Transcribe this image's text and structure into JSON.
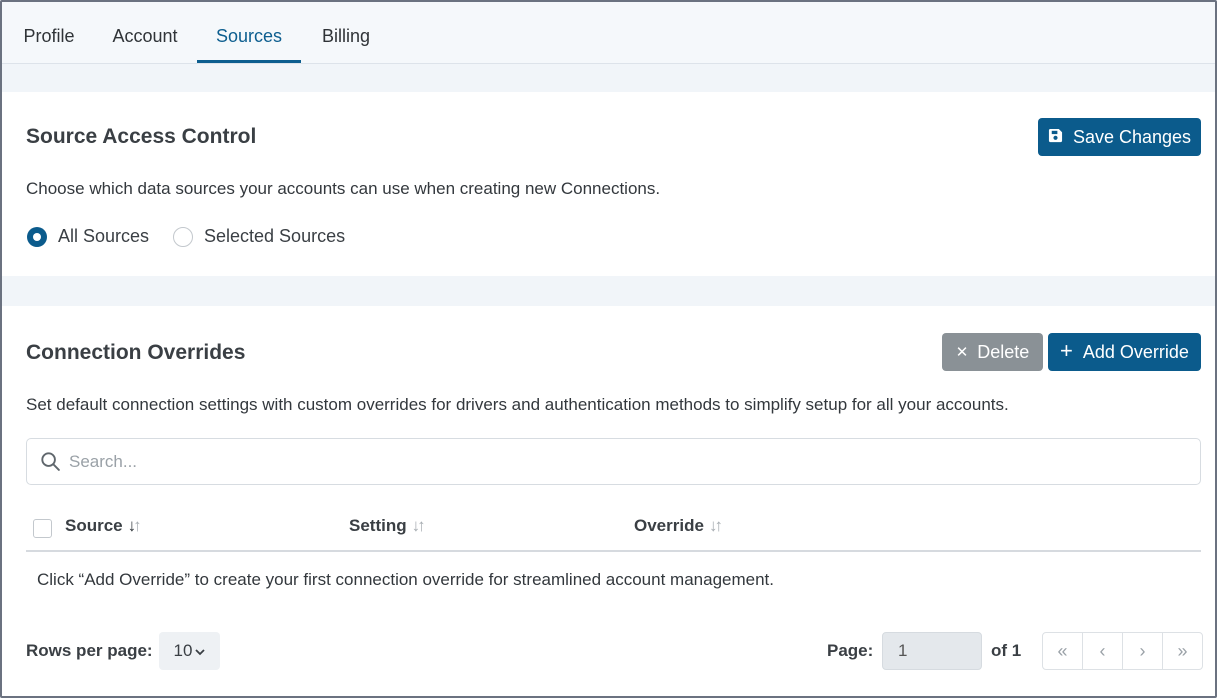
{
  "tabs": [
    {
      "label": "Profile"
    },
    {
      "label": "Account"
    },
    {
      "label": "Sources",
      "active": true
    },
    {
      "label": "Billing"
    }
  ],
  "access": {
    "title": "Source Access Control",
    "save_label": "Save Changes",
    "description": "Choose which data sources your accounts can use when creating new Connections.",
    "options": [
      {
        "label": "All Sources",
        "selected": true
      },
      {
        "label": "Selected Sources",
        "selected": false
      }
    ]
  },
  "overrides": {
    "title": "Connection Overrides",
    "delete_label": "Delete",
    "add_label": "Add Override",
    "description": "Set default connection settings with custom overrides for drivers and authentication methods to simplify setup for all your accounts.",
    "search_placeholder": "Search...",
    "columns": [
      {
        "label": "Source",
        "sorted": "desc"
      },
      {
        "label": "Setting"
      },
      {
        "label": "Override"
      }
    ],
    "empty_message": "Click “Add Override” to create your first connection override for streamlined account management."
  },
  "pagination": {
    "rows_label": "Rows per page:",
    "rows_value": "10",
    "page_label": "Page:",
    "page_value": "1",
    "of_label": "of 1"
  },
  "colors": {
    "accent": "#0b5b8c",
    "muted_button": "#8a9196",
    "background": "#f1f5f9"
  }
}
